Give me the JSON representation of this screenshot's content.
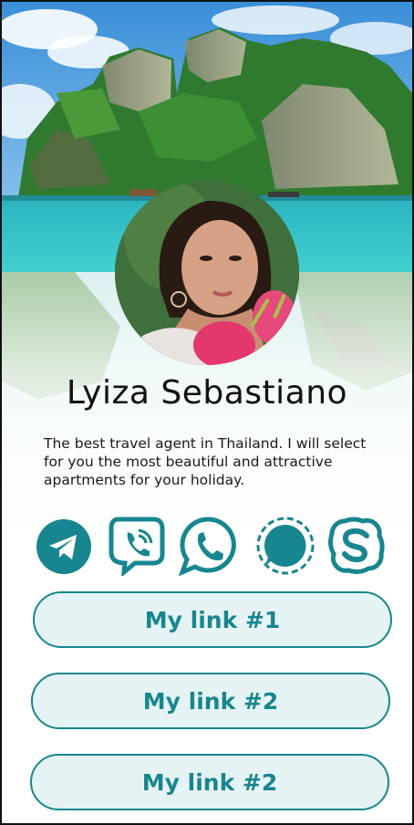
{
  "profile": {
    "name": "Lyiza Sebastiano",
    "bio": "The best travel agent in Thailand. I will select for you the most beautiful and attractive apartments for your holiday."
  },
  "socials": [
    {
      "icon": "telegram-icon"
    },
    {
      "icon": "viber-icon"
    },
    {
      "icon": "whatsapp-icon"
    },
    {
      "icon": "signal-icon"
    },
    {
      "icon": "skype-icon"
    }
  ],
  "links": [
    {
      "label": "My link #1"
    },
    {
      "label": "My link #2"
    },
    {
      "label": "My link #2"
    }
  ],
  "colors": {
    "accent": "#17868f",
    "button_fill": "#e6f3f4",
    "sea": "#35c2c6"
  }
}
